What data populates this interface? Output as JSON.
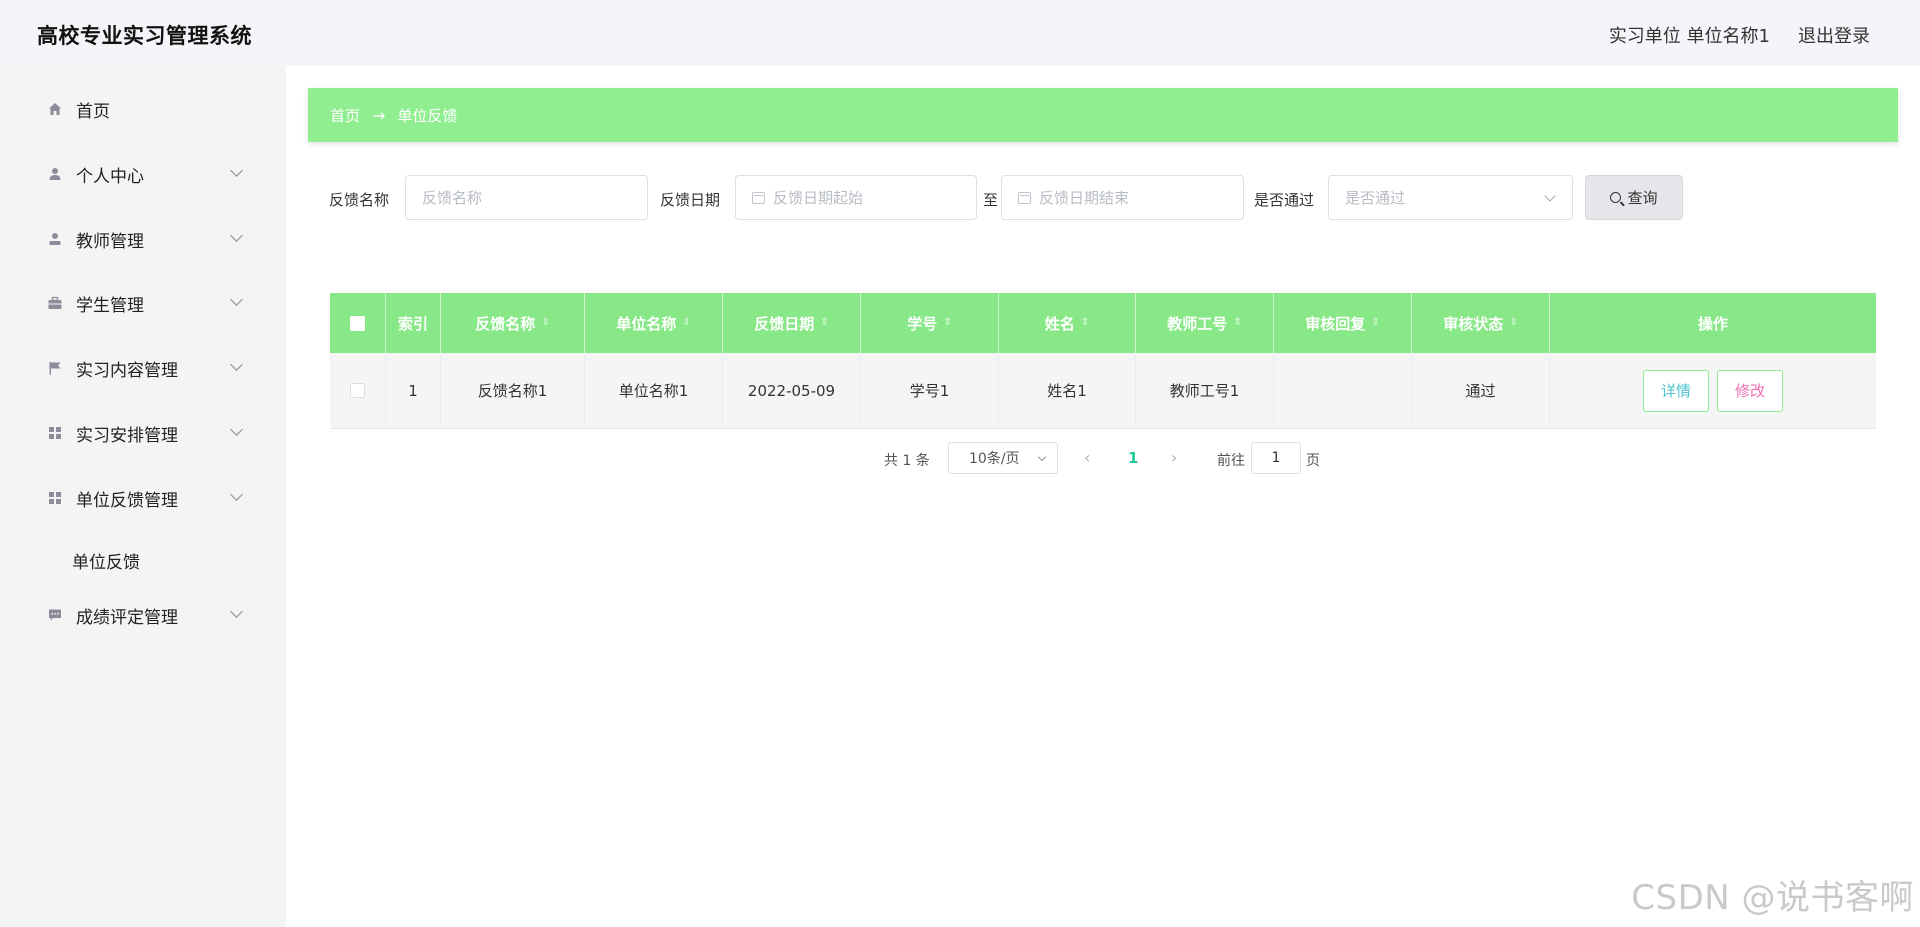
{
  "header": {
    "app_title": "高校专业实习管理系统",
    "user_info": "实习单位 单位名称1",
    "logout": "退出登录"
  },
  "sidebar": {
    "items": [
      {
        "label": "首页",
        "icon": "home-icon"
      },
      {
        "label": "个人中心",
        "icon": "user-icon"
      },
      {
        "label": "教师管理",
        "icon": "teacher-icon"
      },
      {
        "label": "学生管理",
        "icon": "briefcase-icon"
      },
      {
        "label": "实习内容管理",
        "icon": "flag-icon"
      },
      {
        "label": "实习安排管理",
        "icon": "grid-icon"
      },
      {
        "label": "单位反馈管理",
        "icon": "grid-icon"
      },
      {
        "label": "成绩评定管理",
        "icon": "chat-icon"
      }
    ],
    "submenu": {
      "label": "单位反馈"
    }
  },
  "breadcrumb": {
    "home": "首页",
    "arrow": "→",
    "current": "单位反馈"
  },
  "search": {
    "name_label": "反馈名称",
    "name_placeholder": "反馈名称",
    "date_label": "反馈日期",
    "date_start_placeholder": "反馈日期起始",
    "date_to": "至",
    "date_end_placeholder": "反馈日期结束",
    "pass_label": "是否通过",
    "pass_placeholder": "是否通过",
    "query_button": "查询"
  },
  "table": {
    "columns": [
      "索引",
      "反馈名称",
      "单位名称",
      "反馈日期",
      "学号",
      "姓名",
      "教师工号",
      "审核回复",
      "审核状态",
      "操作"
    ],
    "rows": [
      {
        "index": "1",
        "feedback_name": "反馈名称1",
        "unit_name": "单位名称1",
        "feedback_date": "2022-05-09",
        "student_no": "学号1",
        "name": "姓名1",
        "teacher_no": "教师工号1",
        "review_reply": "",
        "review_status": "通过",
        "detail": "详情",
        "edit": "修改"
      }
    ]
  },
  "pagination": {
    "total": "共 1 条",
    "page_size": "10条/页",
    "current_page": "1",
    "goto_label": "前往",
    "goto_value": "1",
    "page_suffix": "页"
  },
  "watermark": "CSDN @说书客啊",
  "colors": {
    "accent": "#90ee90",
    "header_green": "#88e888",
    "active_page": "#20c997"
  }
}
